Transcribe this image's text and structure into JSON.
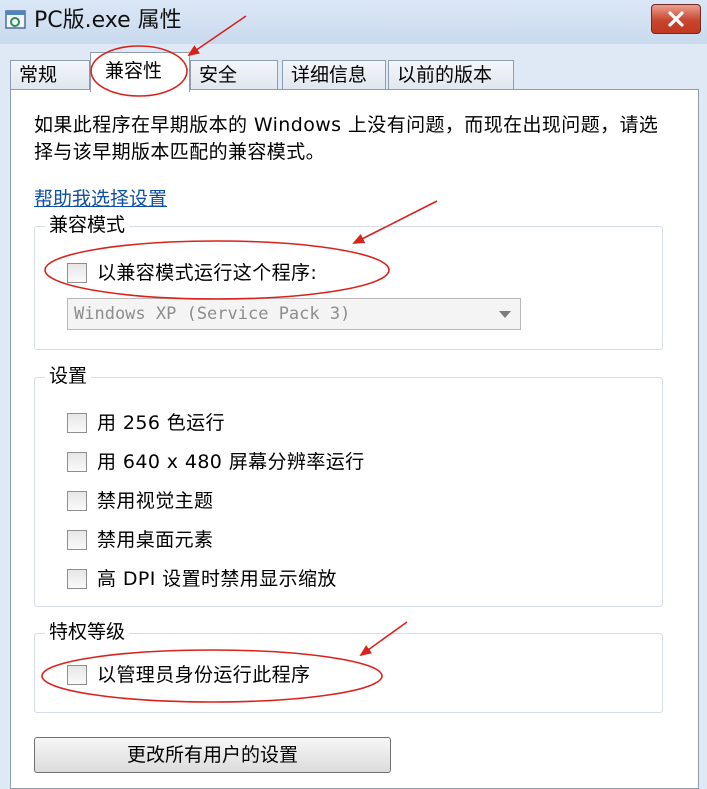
{
  "window": {
    "title": "PC版.exe 属性",
    "icon": "app-icon",
    "close_icon": "close-icon"
  },
  "tabs": [
    {
      "label": "常规"
    },
    {
      "label": "兼容性",
      "active": true
    },
    {
      "label": "安全"
    },
    {
      "label": "详细信息"
    },
    {
      "label": "以前的版本"
    }
  ],
  "intro_text": "如果此程序在早期版本的 Windows 上没有问题，而现在出现问题，请选择与该早期版本匹配的兼容模式。",
  "help_link": "帮助我选择设置",
  "compat_mode": {
    "group_label": "兼容模式",
    "checkbox_label": "以兼容模式运行这个程序:",
    "checked": false,
    "os_select_value": "Windows XP (Service Pack 3)"
  },
  "settings": {
    "group_label": "设置",
    "options": [
      {
        "label": "用 256 色运行",
        "checked": false
      },
      {
        "label": "用 640 x 480 屏幕分辨率运行",
        "checked": false
      },
      {
        "label": "禁用视觉主题",
        "checked": false
      },
      {
        "label": "禁用桌面元素",
        "checked": false
      },
      {
        "label": "高 DPI 设置时禁用显示缩放",
        "checked": false
      }
    ]
  },
  "privilege": {
    "group_label": "特权等级",
    "checkbox_label": "以管理员身份运行此程序",
    "checked": false
  },
  "change_all_users_button": "更改所有用户的设置",
  "colors": {
    "annotation": "#d9221c",
    "link": "#0f4fa8",
    "close_button": "#c9452f"
  }
}
